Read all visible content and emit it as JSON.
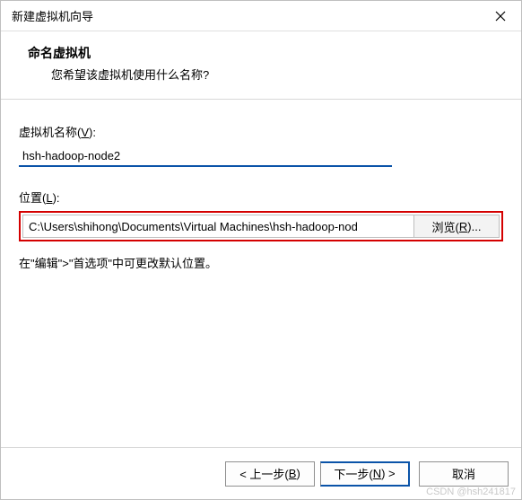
{
  "window": {
    "title": "新建虚拟机向导"
  },
  "header": {
    "title": "命名虚拟机",
    "subtitle": "您希望该虚拟机使用什么名称?"
  },
  "name_field": {
    "label_pre": "虚拟机名称(",
    "label_ul": "V",
    "label_post": "):",
    "value": "hsh-hadoop-node2"
  },
  "location_field": {
    "label_pre": "位置(",
    "label_ul": "L",
    "label_post": "):",
    "value": "C:\\Users\\shihong\\Documents\\Virtual Machines\\hsh-hadoop-nod",
    "browse_pre": "浏览(",
    "browse_ul": "R",
    "browse_post": ")..."
  },
  "hint": "在\"编辑\">\"首选项\"中可更改默认位置。",
  "footer": {
    "back_pre": "< 上一步(",
    "back_ul": "B",
    "back_post": ")",
    "next_pre": "下一步(",
    "next_ul": "N",
    "next_post": ") >",
    "cancel": "取消"
  },
  "watermark": "CSDN @hsh241817"
}
